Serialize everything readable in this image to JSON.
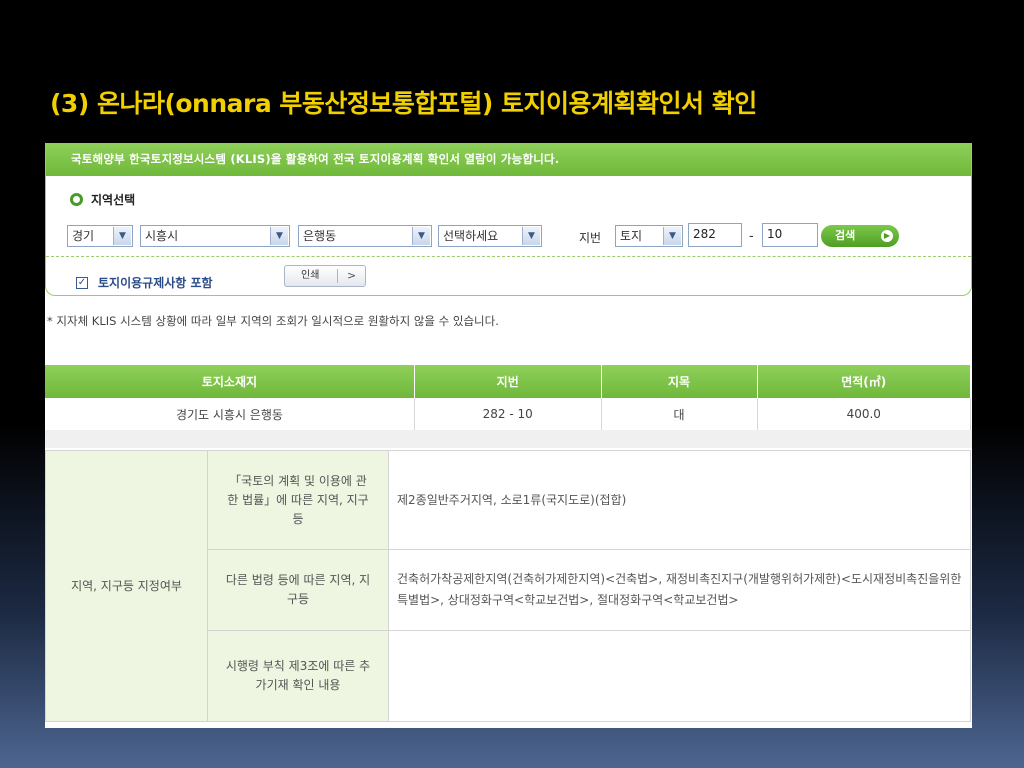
{
  "slide": {
    "title": "(3) 온나라(onnara 부동산정보통합포털) 토지이용계획확인서 확인"
  },
  "colors": {
    "title": "#f2d000",
    "accent_green": "#6fb83a",
    "zone_label_bg": "#eef5e0"
  },
  "search": {
    "notice": "국토해양부 한국토지정보시스템 (KLIS)을 활용하여 전국 토지이용계획 확인서 열람이 가능합니다.",
    "region_title": "지역선택",
    "province": "경기",
    "city": "시흥시",
    "dong": "은행동",
    "ri": "선택하세요",
    "jibeon_label": "지번",
    "land_type": "토지",
    "main_number": "282",
    "dash": "-",
    "sub_number": "10",
    "search_button": "검색",
    "regulation_label": "토지이용규제사항 포함",
    "print_button": "인쇄"
  },
  "footnote": "* 지자체 KLIS 시스템 상황에 따라 일부 지역의 조회가 일시적으로 원활하지 않을 수 있습니다.",
  "land_table": {
    "headers": [
      "토지소재지",
      "지번",
      "지목",
      "면적(㎡)"
    ],
    "row": [
      "경기도 시흥시 은행동",
      "282 - 10",
      "대",
      "400.0"
    ]
  },
  "zone_table": {
    "group_label": "지역, 지구등 지정여부",
    "rows": [
      {
        "label": "「국토의 계획 및 이용에 관한 법률」에 따른 지역, 지구등",
        "value": "제2종일반주거지역, 소로1류(국지도로)(접합)"
      },
      {
        "label": "다른 법령 등에 따른 지역, 지구등",
        "value": "건축허가착공제한지역(건축허가제한지역)<건축법>, 재정비촉진지구(개발행위허가제한)<도시재정비촉진을위한특별법>, 상대정화구역<학교보건법>, 절대정화구역<학교보건법>"
      },
      {
        "label": "시행령 부칙 제3조에 따른 추가기재 확인 내용",
        "value": ""
      }
    ]
  }
}
